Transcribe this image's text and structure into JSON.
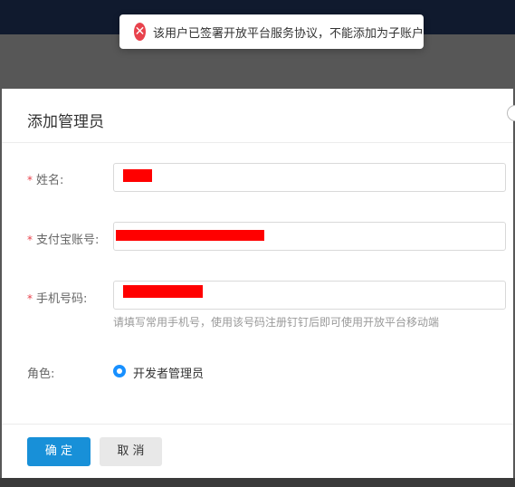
{
  "toast": {
    "icon": "error-circle-icon",
    "message": "该用户已签署开放平台服务协议，不能添加为子账户",
    "color": "#e8424c"
  },
  "dialog": {
    "title": "添加管理员",
    "fields": {
      "name": {
        "required_mark": "*",
        "label": "姓名:"
      },
      "alipay": {
        "required_mark": "*",
        "label": "支付宝账号:"
      },
      "phone": {
        "required_mark": "*",
        "label": "手机号码:",
        "hint": "请填写常用手机号，使用该号码注册钉钉后即可使用开放平台移动端"
      },
      "role": {
        "label": "角色:",
        "option": "开发者管理员"
      }
    },
    "buttons": {
      "ok": "确 定",
      "cancel": "取 消"
    }
  },
  "colors": {
    "primary": "#1890d8",
    "redaction": "#ff0000",
    "topbar": "#101a2e"
  }
}
